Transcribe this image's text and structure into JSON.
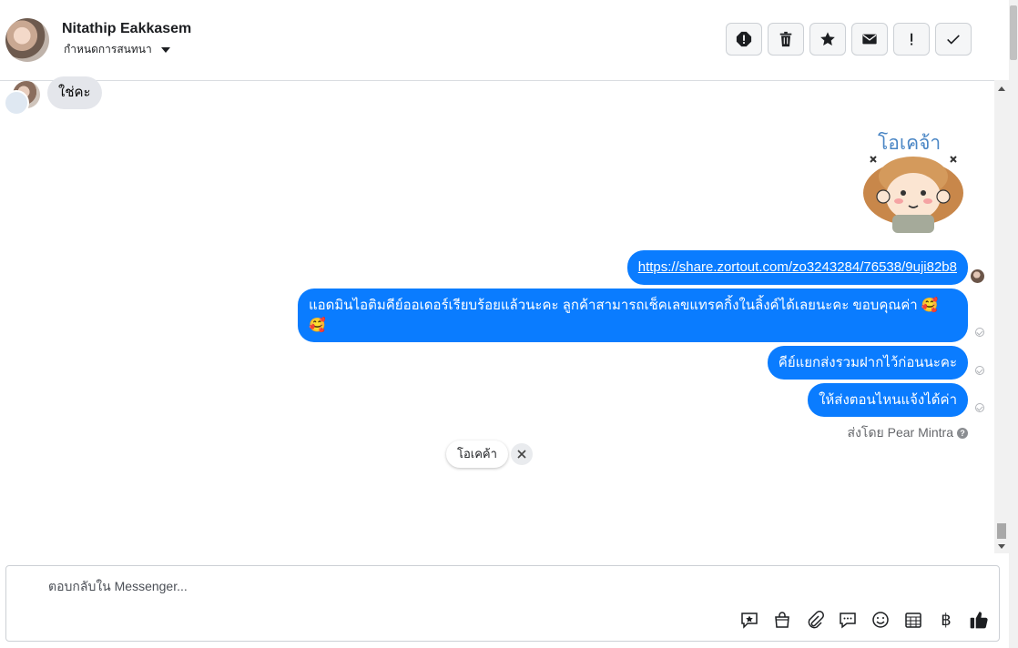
{
  "header": {
    "name": "Nitathip Eakkasem",
    "settings_label": "กำหนดการสนทนา",
    "tools": [
      "spam-icon",
      "delete-icon",
      "star-icon",
      "mark-unread-icon",
      "important-icon",
      "done-icon"
    ]
  },
  "messages": {
    "incoming_text": "ใช่คะ",
    "sticker_text": "โอเคจ้า",
    "outgoing": {
      "link": "https://share.zortout.com/zo3243284/76538/9uji82b8",
      "m1": "แอดมินไอติมคีย์ออเดอร์เรียบร้อยแล้วนะคะ ลูกค้าสามารถเช็คเลขแทรคกิ้งในลิ้งค์ได้เลยนะคะ ขอบคุณค่า 🥰",
      "m1_line2": "🥰",
      "m2": "คีย์แยกส่งรวมฝากไว้ก่อนนะคะ",
      "m3": "ให้ส่งตอนไหนแจ้งได้ค่า"
    },
    "sent_by": "ส่งโดย Pear Mintra",
    "quick_reply": "โอเคค้า"
  },
  "composer": {
    "placeholder": "ตอบกลับใน Messenger...",
    "tools": [
      "saved-reply-icon",
      "shop-icon",
      "attach-icon",
      "chat-bubble-icon",
      "emoji-icon",
      "calendar-icon",
      "baht-icon",
      "like-icon"
    ],
    "baht_symbol": "฿"
  },
  "colors": {
    "accent": "#0a7cff",
    "incoming_bubble": "#e4e6eb"
  }
}
